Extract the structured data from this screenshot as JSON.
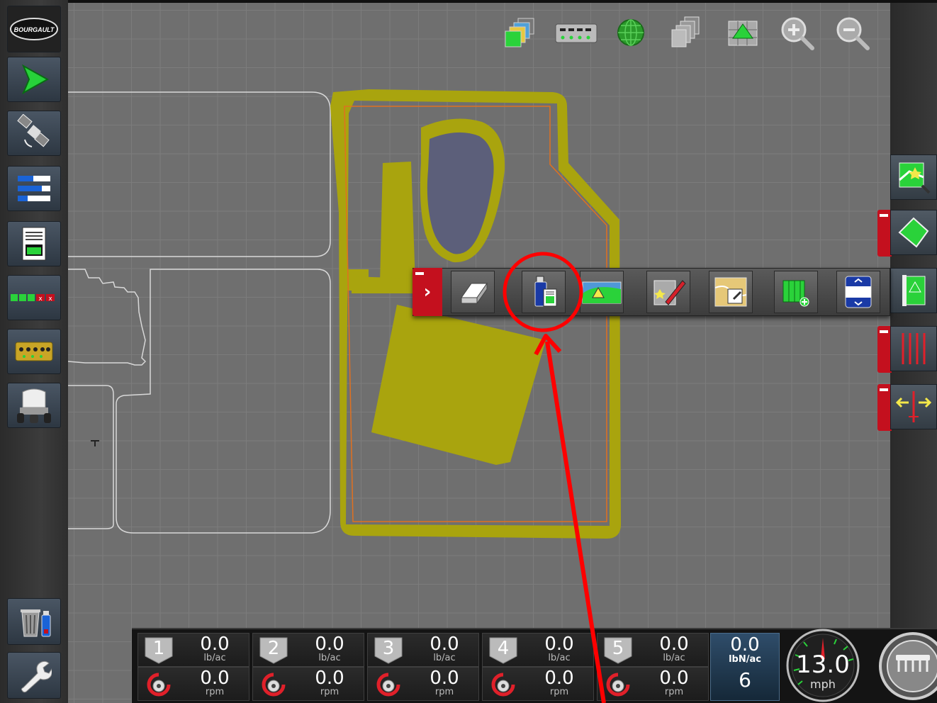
{
  "brand": {
    "logo_text": "BOURGAULT"
  },
  "left_toolbar": [
    {
      "name": "logo-button",
      "icon": "bourgault-logo"
    },
    {
      "name": "guidance-button",
      "icon": "green-arrow-icon"
    },
    {
      "name": "gps-button",
      "icon": "satellite-icon"
    },
    {
      "name": "job-info-button",
      "icon": "bars-list-icon"
    },
    {
      "name": "reports-button",
      "icon": "document-icon"
    },
    {
      "name": "sections-button",
      "icon": "section-control-icon"
    },
    {
      "name": "meters-button",
      "icon": "meters-icon"
    },
    {
      "name": "implement-button",
      "icon": "air-cart-icon"
    },
    {
      "name": "data-manager-button",
      "icon": "trash-usb-icon"
    },
    {
      "name": "settings-button",
      "icon": "wrench-icon"
    }
  ],
  "top_icons": [
    "layers-icon",
    "meters-icon",
    "globe-icon",
    "pages-icon",
    "field-view-icon",
    "zoom-in-icon",
    "zoom-out-icon"
  ],
  "popup_toolbar": [
    "eraser-icon",
    "usb-coverage-icon",
    "field-marker-icon",
    "edit-map-icon",
    "import-map-icon",
    "add-section-icon",
    "scroll-list-icon"
  ],
  "right_toolbar": [
    "map-search-icon",
    "field-boundary-icon",
    "hazard-icon",
    "guidance-lines-icon",
    "shift-icon"
  ],
  "status_bar": {
    "meters": [
      {
        "id": "1",
        "rate": "0.0",
        "rate_unit": "lb/ac",
        "rpm": "0.0",
        "rpm_unit": "rpm"
      },
      {
        "id": "2",
        "rate": "0.0",
        "rate_unit": "lb/ac",
        "rpm": "0.0",
        "rpm_unit": "rpm"
      },
      {
        "id": "3",
        "rate": "0.0",
        "rate_unit": "lb/ac",
        "rpm": "0.0",
        "rpm_unit": "rpm"
      },
      {
        "id": "4",
        "rate": "0.0",
        "rate_unit": "lb/ac",
        "rpm": "0.0",
        "rpm_unit": "rpm"
      },
      {
        "id": "5",
        "rate": "0.0",
        "rate_unit": "lb/ac",
        "rpm": "0.0",
        "rpm_unit": "rpm"
      }
    ],
    "target": {
      "value": "0.0",
      "unit": "lbN/ac",
      "count": "6"
    },
    "speed": {
      "value": "13.0",
      "unit": "mph"
    }
  },
  "colors": {
    "coverage": "#a9a40e",
    "accent_red": "#c4101e",
    "boundary_orange": "#e07020",
    "annotation_red": "#ff0000",
    "obstacle": "#5c5f7a"
  }
}
